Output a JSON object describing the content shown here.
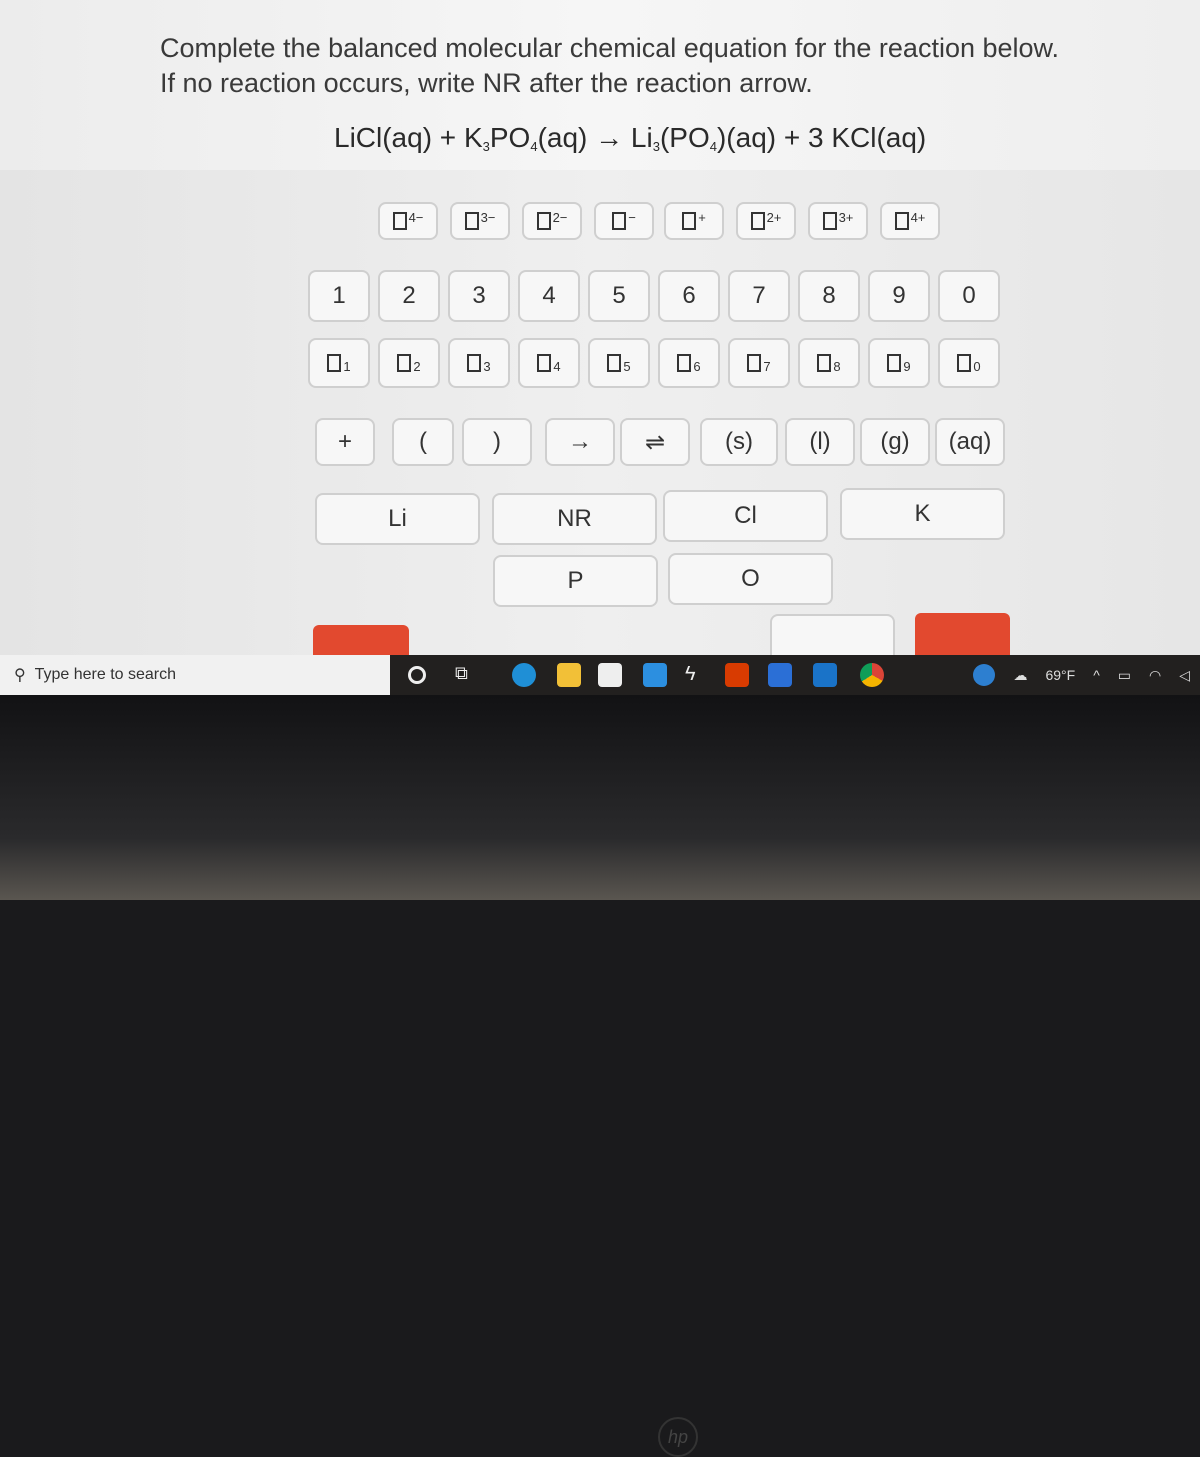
{
  "question": {
    "line1": "Complete the balanced molecular chemical equation for the reaction below.",
    "line2": "If no reaction occurs, write NR after the reaction arrow."
  },
  "equation": {
    "r1": "LiCl(aq) + K",
    "r1s": "3",
    "r2": "PO",
    "r2s": "4",
    "r3": "(aq) → Li",
    "r3s": "3",
    "r4": "(PO",
    "r4s": "4",
    "r5": ")(aq) + 3 KCl(aq)"
  },
  "charges": [
    "4−",
    "3−",
    "2−",
    "−",
    "+",
    "2+",
    "3+",
    "4+"
  ],
  "digits": [
    "1",
    "2",
    "3",
    "4",
    "5",
    "6",
    "7",
    "8",
    "9",
    "0"
  ],
  "subscripts": [
    "1",
    "2",
    "3",
    "4",
    "5",
    "6",
    "7",
    "8",
    "9",
    "0"
  ],
  "symbols": [
    "+",
    "(",
    ")",
    "→",
    "⇌",
    "(s)",
    "(l)",
    "(g)",
    "(aq)"
  ],
  "elements": [
    "Li",
    "NR",
    "Cl",
    "K",
    "P",
    "O"
  ],
  "taskbar": {
    "search_placeholder": "Type here to search",
    "weather": "69°F",
    "icons": [
      "cortana-icon",
      "task-view-icon",
      "edge-icon",
      "file-explorer-icon",
      "store-icon",
      "mail-icon",
      "app-icon",
      "office-icon",
      "word-icon",
      "outlook-icon",
      "chrome-icon"
    ]
  },
  "brand": "hp"
}
